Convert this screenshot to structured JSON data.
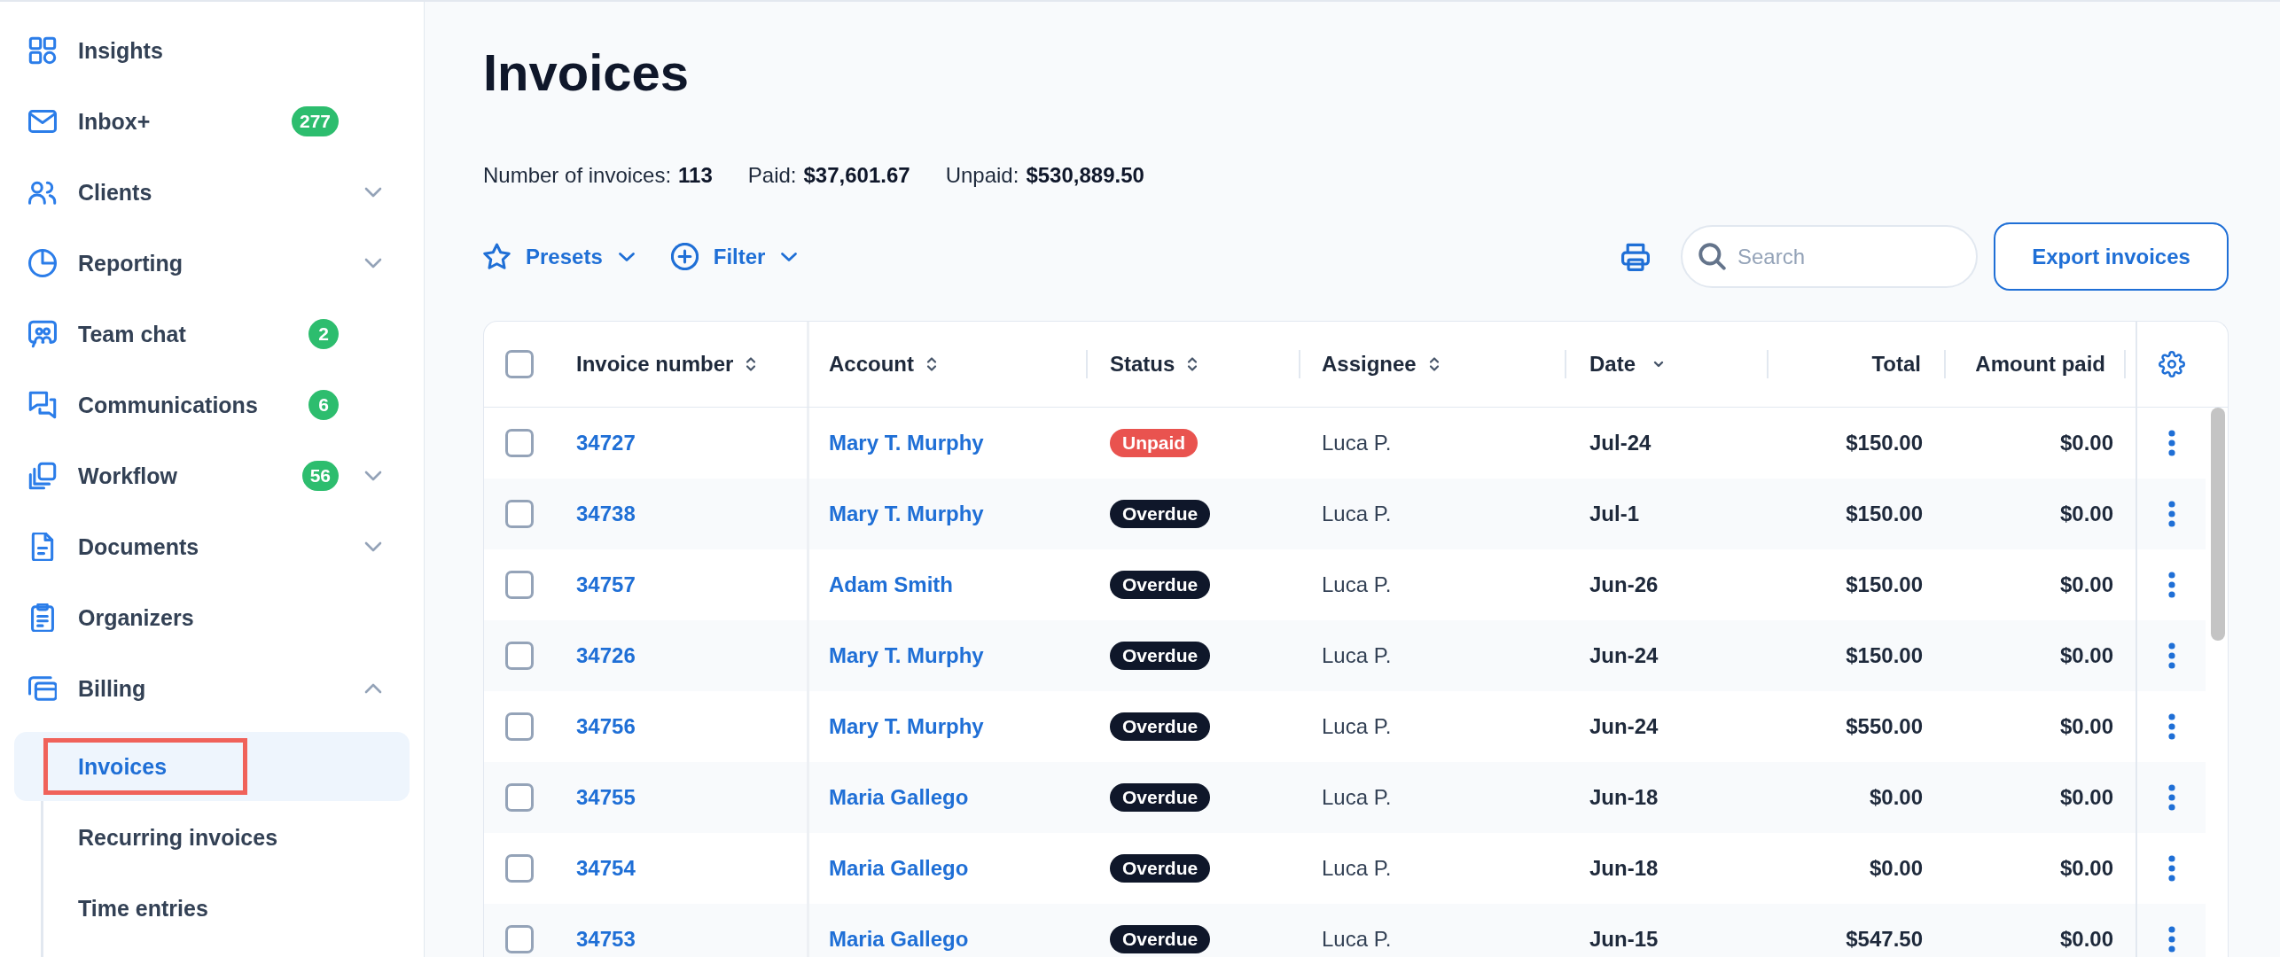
{
  "sidebar": {
    "items": [
      {
        "label": "Insights",
        "kind": "link",
        "selected": false
      },
      {
        "label": "Inbox+",
        "kind": "link",
        "selected": false,
        "badge": "277"
      },
      {
        "label": "Clients",
        "kind": "group",
        "selected": false,
        "expanded": false
      },
      {
        "label": "Reporting",
        "kind": "group",
        "selected": false,
        "expanded": false
      },
      {
        "label": "Team chat",
        "kind": "link",
        "selected": false,
        "badge": "2"
      },
      {
        "label": "Communications",
        "kind": "link",
        "selected": false,
        "badge": "6"
      },
      {
        "label": "Workflow",
        "kind": "group",
        "selected": false,
        "expanded": false,
        "badge": "56"
      },
      {
        "label": "Documents",
        "kind": "group",
        "selected": false,
        "expanded": false
      },
      {
        "label": "Organizers",
        "kind": "link",
        "selected": false
      },
      {
        "label": "Billing",
        "kind": "group",
        "selected": false,
        "expanded": true,
        "children": [
          {
            "label": "Invoices",
            "selected": true,
            "highlighted": true
          },
          {
            "label": "Recurring invoices",
            "selected": false,
            "highlighted": false
          },
          {
            "label": "Time entries",
            "selected": false,
            "highlighted": false
          }
        ]
      }
    ]
  },
  "page": {
    "title": "Invoices",
    "summary": [
      {
        "label": "Number of invoices:",
        "value": "113"
      },
      {
        "label": "Paid:",
        "value": "$37,601.67"
      },
      {
        "label": "Unpaid:",
        "value": "$530,889.50"
      }
    ]
  },
  "toolbar": {
    "filters": [
      {
        "label": "Presets",
        "kind": "presets"
      },
      {
        "label": "Filter",
        "kind": "filter"
      }
    ],
    "search": {
      "placeholder": "Search"
    },
    "export_button": "Export invoices"
  },
  "table": {
    "select_all": {
      "checked": false
    },
    "columns": [
      {
        "label": "Invoice number",
        "sorted": false
      },
      {
        "label": "Account",
        "sorted": false
      },
      {
        "label": "Status",
        "sorted": false
      },
      {
        "label": "Assignee",
        "sorted": false
      },
      {
        "label": "Date",
        "sorted": true
      },
      {
        "label": "Total"
      },
      {
        "label": "Amount paid"
      }
    ],
    "rows": [
      {
        "checked": false,
        "invoice_number": "34727",
        "account": "Mary T. Murphy",
        "status": {
          "label": "Unpaid",
          "color": "#e9534f"
        },
        "assignee": "Luca P.",
        "date": "Jul-24",
        "total": "$150.00",
        "amount_paid": "$0.00"
      },
      {
        "checked": false,
        "invoice_number": "34738",
        "account": "Mary T. Murphy",
        "status": {
          "label": "Overdue",
          "color": "#0f172a"
        },
        "assignee": "Luca P.",
        "date": "Jul-1",
        "total": "$150.00",
        "amount_paid": "$0.00"
      },
      {
        "checked": false,
        "invoice_number": "34757",
        "account": "Adam Smith",
        "status": {
          "label": "Overdue",
          "color": "#0f172a"
        },
        "assignee": "Luca P.",
        "date": "Jun-26",
        "total": "$150.00",
        "amount_paid": "$0.00"
      },
      {
        "checked": false,
        "invoice_number": "34726",
        "account": "Mary T. Murphy",
        "status": {
          "label": "Overdue",
          "color": "#0f172a"
        },
        "assignee": "Luca P.",
        "date": "Jun-24",
        "total": "$150.00",
        "amount_paid": "$0.00"
      },
      {
        "checked": false,
        "invoice_number": "34756",
        "account": "Mary T. Murphy",
        "status": {
          "label": "Overdue",
          "color": "#0f172a"
        },
        "assignee": "Luca P.",
        "date": "Jun-24",
        "total": "$550.00",
        "amount_paid": "$0.00"
      },
      {
        "checked": false,
        "invoice_number": "34755",
        "account": "Maria Gallego",
        "status": {
          "label": "Overdue",
          "color": "#0f172a"
        },
        "assignee": "Luca P.",
        "date": "Jun-18",
        "total": "$0.00",
        "amount_paid": "$0.00"
      },
      {
        "checked": false,
        "invoice_number": "34754",
        "account": "Maria Gallego",
        "status": {
          "label": "Overdue",
          "color": "#0f172a"
        },
        "assignee": "Luca P.",
        "date": "Jun-18",
        "total": "$0.00",
        "amount_paid": "$0.00"
      },
      {
        "checked": false,
        "invoice_number": "34753",
        "account": "Maria Gallego",
        "status": {
          "label": "Overdue",
          "color": "#0f172a"
        },
        "assignee": "Luca P.",
        "date": "Jun-15",
        "total": "$547.50",
        "amount_paid": "$0.00"
      }
    ]
  }
}
